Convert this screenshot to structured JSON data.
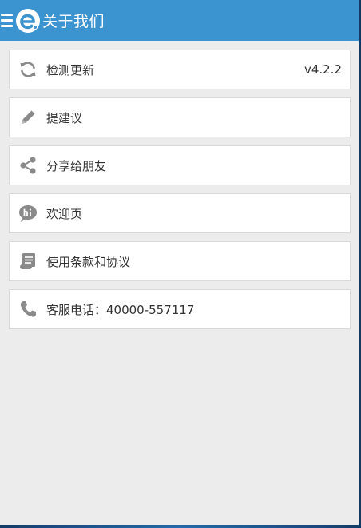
{
  "header": {
    "title": "关于我们"
  },
  "menu": [
    {
      "label": "检测更新",
      "value": "v4.2.2",
      "icon": "refresh-icon"
    },
    {
      "label": "提建议",
      "icon": "pencil-icon"
    },
    {
      "label": "分享给朋友",
      "icon": "share-icon"
    },
    {
      "label": "欢迎页",
      "icon": "hi-bubble-icon"
    },
    {
      "label": "使用条款和协议",
      "icon": "scroll-icon"
    },
    {
      "label": "客服电话：40000-557117",
      "icon": "phone-icon"
    }
  ],
  "colors": {
    "appbar": "#3b93d0",
    "background": "#ececec",
    "icon": "#8a8a8a"
  }
}
